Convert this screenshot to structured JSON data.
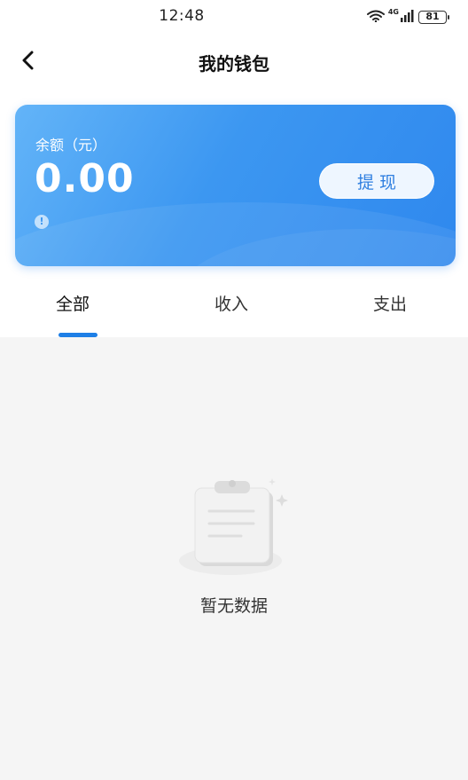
{
  "status_bar": {
    "time": "12:48",
    "network_label": "4G",
    "battery_level": "81"
  },
  "header": {
    "title": "我的钱包",
    "back_icon": "chevron-left-icon"
  },
  "balance_card": {
    "label": "余额（元）",
    "amount": "0.00",
    "info_icon": "!",
    "withdraw_label": "提现",
    "gradient_colors": [
      "#63b4f8",
      "#2f88ee"
    ]
  },
  "tabs": [
    {
      "label": "全部",
      "active": true
    },
    {
      "label": "收入",
      "active": false
    },
    {
      "label": "支出",
      "active": false
    }
  ],
  "accent_color": "#1e7fe6",
  "empty_state": {
    "icon": "empty-clipboard-icon",
    "text": "暂无数据"
  }
}
